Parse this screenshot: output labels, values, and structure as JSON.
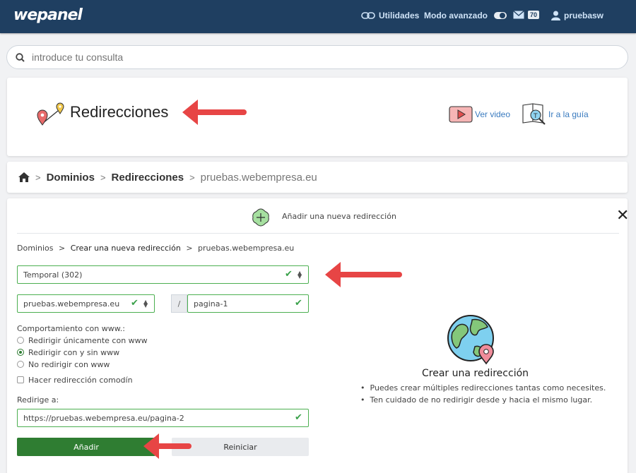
{
  "topbar": {
    "logo": "wepanel",
    "utilities": "Utilidades",
    "advanced_mode": "Modo avanzado",
    "mail_count": "70",
    "username": "pruebasw"
  },
  "search": {
    "placeholder": "introduce tu consulta"
  },
  "page": {
    "title": "Redirecciones",
    "video_link": "Ver video",
    "guide_link": "Ir a la guía"
  },
  "breadcrumb": {
    "items": [
      "Dominios",
      "Redirecciones"
    ],
    "current": "pruebas.webempresa.eu"
  },
  "panel": {
    "title": "Añadir una nueva redirección",
    "close": "✕",
    "sub_breadcrumb": {
      "first": "Dominios",
      "second": "Crear una nueva redirección",
      "third": "pruebas.webempresa.eu"
    },
    "type_select": "Temporal (302)",
    "domain_select": "pruebas.webempresa.eu",
    "slash": "/",
    "path_value": "pagina-1",
    "www_label": "Comportamiento con www.:",
    "www_options": [
      "Redirigir únicamente con www",
      "Redirigir con y sin www",
      "No redirigir con www"
    ],
    "www_selected": 1,
    "wildcard_label": "Hacer redirección comodín",
    "redirect_to_label": "Redirige a:",
    "redirect_to_value": "https://pruebas.webempresa.eu/pagina-2",
    "add_button": "Añadir",
    "reset_button": "Reiniciar"
  },
  "info": {
    "title": "Crear una redirección",
    "bullets": [
      "Puedes crear múltiples redirecciones tantas como necesites.",
      "Ten cuidado de no redirigir desde y hacia el mismo lugar."
    ]
  },
  "colors": {
    "topbar": "#1f3f61",
    "accent": "#2f7d32",
    "arrow": "#e74545",
    "link": "#3a7bbf"
  }
}
